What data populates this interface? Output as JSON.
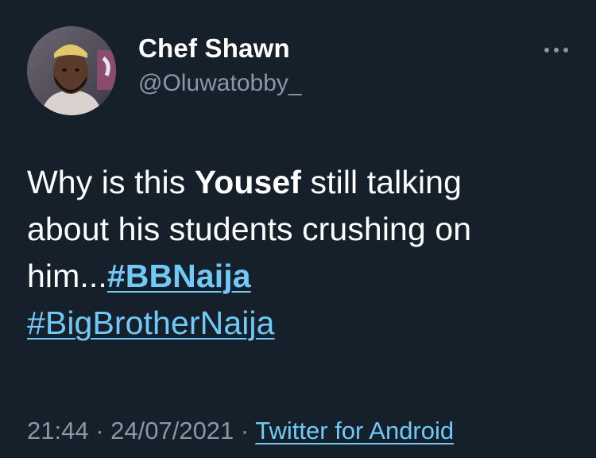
{
  "author": {
    "display_name": "Chef Shawn",
    "handle": "@Oluwatobby_"
  },
  "more_menu": {
    "icon": "more-horizontal-icon"
  },
  "tweet": {
    "line1_prefix": "Why is this ",
    "line1_bold": "Yousef",
    "line1_suffix": " still talking",
    "line2": "about his students crushing on",
    "line3_prefix": "him...",
    "hashtags": [
      "#BBNaija",
      "#BigBrotherNaija"
    ]
  },
  "meta": {
    "time": "21:44",
    "separator": " · ",
    "date": "24/07/2021",
    "source": "Twitter for Android"
  },
  "colors": {
    "background": "#15202b",
    "text": "#ffffff",
    "secondary": "#8899a6",
    "link": "#71c9f8"
  }
}
